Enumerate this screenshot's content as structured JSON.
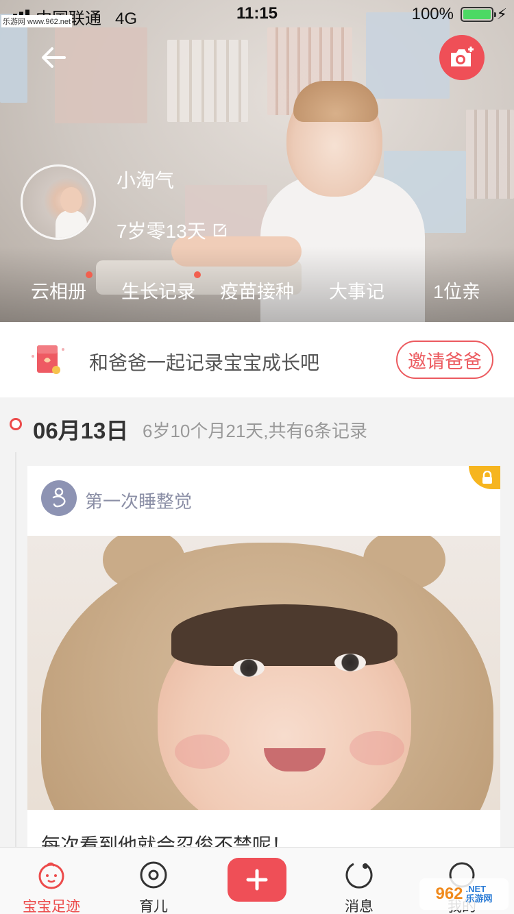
{
  "status_bar": {
    "carrier": "中国联通",
    "network": "4G",
    "time": "11:15",
    "battery": "100%"
  },
  "watermark_top": "乐游网 www.962.net",
  "header": {
    "baby_name": "小淘气",
    "baby_age": "7岁零13天",
    "nav": [
      "云相册",
      "生长记录",
      "疫苗接种",
      "大事记",
      "1位亲"
    ],
    "icons": {
      "back": "back-arrow-icon",
      "camera": "camera-add-icon",
      "edit": "edit-icon"
    }
  },
  "invite": {
    "text": "和爸爸一起记录宝宝成长吧",
    "button": "邀请爸爸"
  },
  "timeline": {
    "date": "06月13日",
    "summary": "6岁10个月21天,共有6条记录",
    "card": {
      "tag": "第一次睡整觉",
      "caption": "每次看到他就会忍俊不禁呢！",
      "locked": true
    }
  },
  "tabbar": {
    "tabs": [
      "宝宝足迹",
      "育儿",
      "消息",
      "我的"
    ],
    "active": "宝宝足迹",
    "accent": "#ec4b4b"
  },
  "watermark_br": {
    "brand": "962",
    "site": ".NET",
    "cn": "乐游网"
  }
}
